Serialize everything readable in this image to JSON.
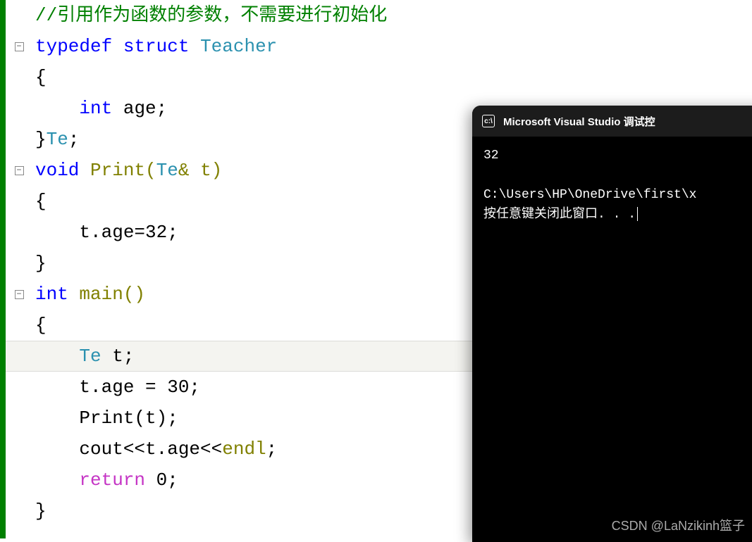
{
  "code": {
    "comment": "//引用作为函数的参数，不需要进行初始化",
    "line2": {
      "typedef": "typedef",
      "struct": "struct",
      "name": "Teacher"
    },
    "line3": "{",
    "line4": {
      "indent": "    ",
      "kw": "int",
      "rest": " age;"
    },
    "line5": {
      "brace": "}",
      "name": "Te",
      "semi": ";"
    },
    "line6": {
      "kw": "void",
      "fn": " Print(",
      "type": "Te",
      "amp": "& t)"
    },
    "line7": "{",
    "line8": "    t.age=32;",
    "line9": "}",
    "line10": {
      "kw": "int",
      "rest": " main()"
    },
    "line11": "{",
    "line12": {
      "indent": "    ",
      "type": "Te",
      "rest": " t;"
    },
    "line13": "    t.age = 30;",
    "line14": "    Print(t);",
    "line15": {
      "indent": "    cout<<t.age<<",
      "endl": "endl",
      "semi": ";"
    },
    "line16": {
      "indent": "    ",
      "kw": "return",
      "rest": " 0;"
    },
    "line17": "}"
  },
  "console": {
    "title": "Microsoft Visual Studio 调试控",
    "output": "32",
    "path": "C:\\Users\\HP\\OneDrive\\first\\x",
    "prompt": "按任意键关闭此窗口. . ."
  },
  "watermark": "CSDN @LaNzikinh篮子"
}
